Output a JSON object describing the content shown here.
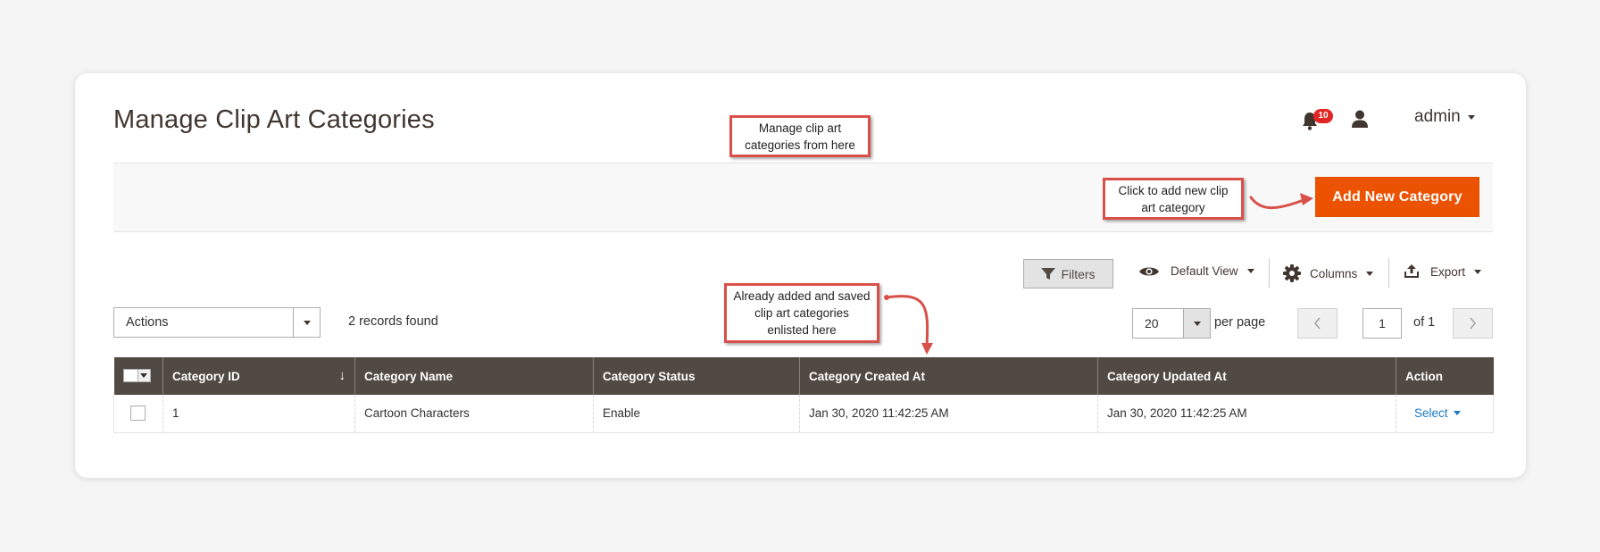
{
  "header": {
    "page_title": "Manage Clip Art Categories",
    "notification_count": "10",
    "user_name": "admin"
  },
  "action_bar": {
    "add_button_label": "Add New Category"
  },
  "annotations": {
    "manage": "Manage clip art categories from here",
    "add": "Click to add new clip art category",
    "list": "Already added and saved clip art categories enlisted here",
    "color": "#d9504a"
  },
  "toolbar": {
    "filters_label": "Filters",
    "view_label": "Default View",
    "columns_label": "Columns",
    "export_label": "Export"
  },
  "mass_actions": {
    "selected": "Actions"
  },
  "records_found": "2 records found",
  "pagination": {
    "per_page_value": "20",
    "per_page_label": "per page",
    "current_page": "1",
    "total_pages_label": "of 1"
  },
  "grid": {
    "columns": [
      "Category ID",
      "Category Name",
      "Category Status",
      "Category Created At",
      "Category Updated At",
      "Action"
    ],
    "rows": [
      {
        "id": "1",
        "name": "Cartoon Characters",
        "status": "Enable",
        "created_at": "Jan 30, 2020 11:42:25 AM",
        "updated_at": "Jan 30, 2020 11:42:25 AM",
        "action": "Select"
      }
    ]
  },
  "colors": {
    "accent": "#eb5202",
    "grid_header": "#514943",
    "link": "#1979c3",
    "badge": "#e22626"
  }
}
